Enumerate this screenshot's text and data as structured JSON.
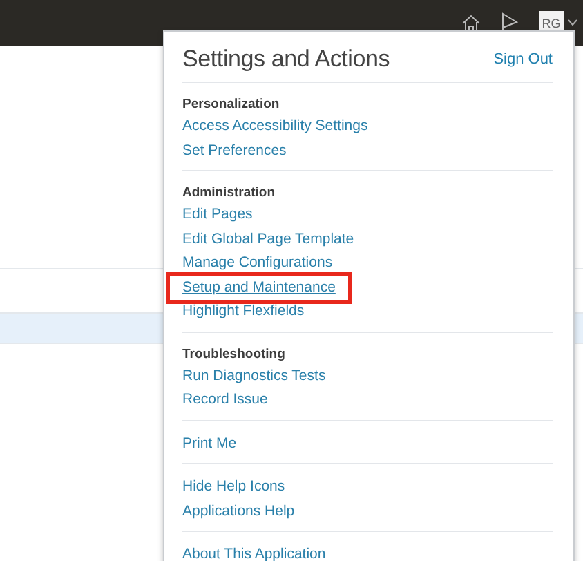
{
  "header": {
    "avatar": "RG"
  },
  "table": {
    "rows": [
      {
        "selected": false
      },
      {
        "selected": true
      },
      {
        "selected": false
      }
    ]
  },
  "menu": {
    "title": "Settings and Actions",
    "sign_out": "Sign Out",
    "groups": [
      {
        "heading": "Personalization",
        "items": [
          {
            "label": "Access Accessibility Settings",
            "highlighted": false
          },
          {
            "label": "Set Preferences",
            "highlighted": false
          }
        ]
      },
      {
        "heading": "Administration",
        "items": [
          {
            "label": "Edit Pages",
            "highlighted": false
          },
          {
            "label": "Edit Global Page Template",
            "highlighted": false
          },
          {
            "label": "Manage Configurations",
            "highlighted": false
          },
          {
            "label": "Setup and Maintenance",
            "highlighted": true
          },
          {
            "label": "Highlight Flexfields",
            "highlighted": false
          }
        ]
      },
      {
        "heading": "Troubleshooting",
        "items": [
          {
            "label": "Run Diagnostics Tests",
            "highlighted": false
          },
          {
            "label": "Record Issue",
            "highlighted": false
          }
        ]
      },
      {
        "items": [
          {
            "label": "Print Me",
            "highlighted": false
          }
        ]
      },
      {
        "items": [
          {
            "label": "Hide Help Icons",
            "highlighted": false
          },
          {
            "label": "Applications Help",
            "highlighted": false
          }
        ]
      },
      {
        "items": [
          {
            "label": "About This Application",
            "highlighted": false
          }
        ]
      }
    ]
  }
}
